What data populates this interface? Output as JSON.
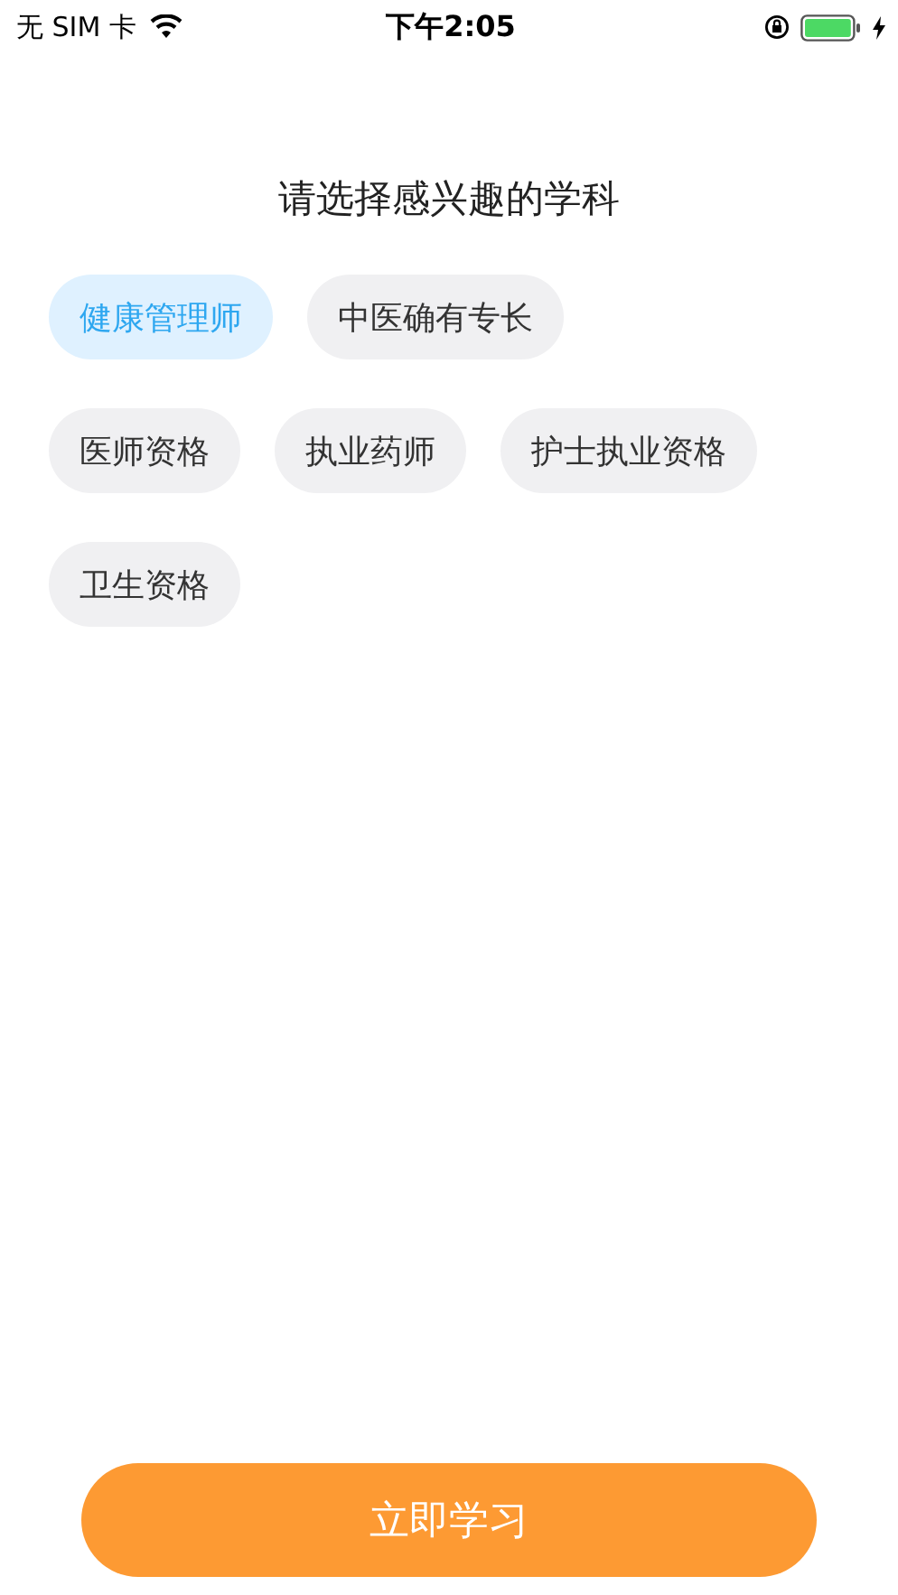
{
  "status_bar": {
    "carrier": "无 SIM 卡",
    "time": "下午2:05"
  },
  "title": "请选择感兴趣的学科",
  "subjects": [
    [
      {
        "label": "健康管理师",
        "selected": true
      },
      {
        "label": "中医确有专长",
        "selected": false
      }
    ],
    [
      {
        "label": "医师资格",
        "selected": false
      },
      {
        "label": "执业药师",
        "selected": false
      },
      {
        "label": "护士执业资格",
        "selected": false
      }
    ],
    [
      {
        "label": "卫生资格",
        "selected": false
      }
    ]
  ],
  "button": "立即学习"
}
